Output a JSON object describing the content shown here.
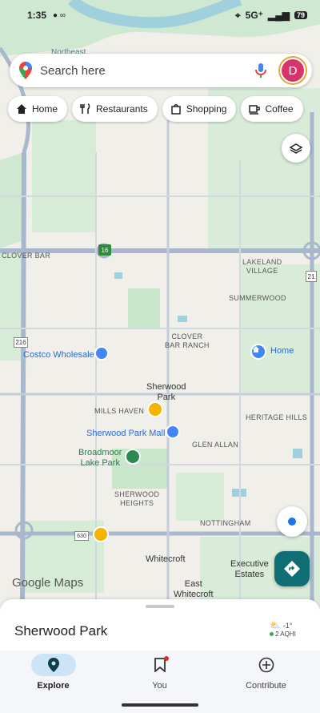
{
  "status": {
    "time": "1:35",
    "network": "5G⁺",
    "battery": "79"
  },
  "search": {
    "placeholder": "Search here",
    "avatar_letter": "D"
  },
  "chips": [
    {
      "label": "Home",
      "icon": "home-icon"
    },
    {
      "label": "Restaurants",
      "icon": "fork-knife-icon"
    },
    {
      "label": "Shopping",
      "icon": "shopping-bag-icon"
    },
    {
      "label": "Coffee",
      "icon": "coffee-icon"
    }
  ],
  "map_labels": {
    "northeast": "Northeast",
    "clover_bar": "CLOVER BAR",
    "lakeland_village": "LAKELAND\nVILLAGE",
    "summerwood": "SUMMERWOOD",
    "clover_bar_ranch": "CLOVER\nBAR RANCH",
    "mills_haven": "MILLS HAVEN",
    "heritage_hills": "HERITAGE HILLS",
    "glen_allan": "GLEN ALLAN",
    "sherwood_heights": "SHERWOOD\nHEIGHTS",
    "nottingham": "NOTTINGHAM",
    "sherwood_park": "Sherwood\nPark",
    "whitecroft": "Whitecroft",
    "east_whitecroft": "East\nWhitecroft",
    "executive_estates": "Executive\nEstates",
    "hwy_16": "16",
    "hwy_21": "21",
    "hwy_216": "216",
    "hwy_630": "630"
  },
  "pois": {
    "costco": "Costco Wholesale",
    "home": "Home",
    "sherwood_mall": "Sherwood Park Mall",
    "broadmoor": "Broadmoor\nLake Park"
  },
  "map_attribution": "Google Maps",
  "sheet": {
    "title": "Sherwood Park",
    "temp": "-1°",
    "aqi": "2 AQHI"
  },
  "nav": [
    {
      "label": "Explore",
      "icon": "explore-pin-icon",
      "active": true
    },
    {
      "label": "You",
      "icon": "bookmark-icon",
      "active": false
    },
    {
      "label": "Contribute",
      "icon": "add-circle-icon",
      "active": false
    }
  ],
  "colors": {
    "road": "#a9b7cc",
    "park": "#c8e6c9",
    "water": "#9fd0dc",
    "accent": "#0f6e73",
    "pin_blue": "#4285f4"
  }
}
